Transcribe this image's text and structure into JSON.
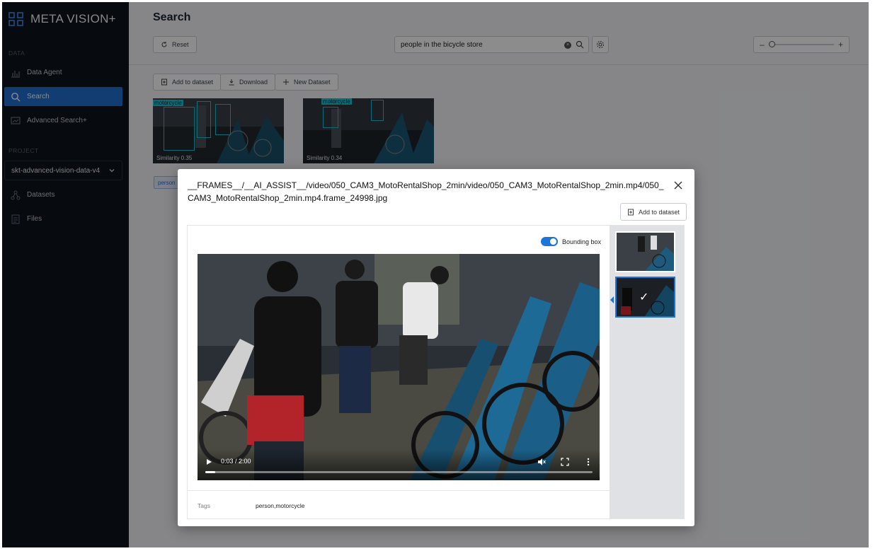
{
  "app": {
    "name": "META VISION+"
  },
  "sidebar": {
    "section_data": "DATA",
    "section_project": "PROJECT",
    "items": [
      {
        "label": "Data Agent",
        "icon": "bar-chart-icon"
      },
      {
        "label": "Search",
        "icon": "search-icon",
        "active": true
      },
      {
        "label": "Advanced Search+",
        "icon": "image-search-icon"
      }
    ],
    "project": "skt-advanced-vision-data-v4",
    "project_items": [
      {
        "label": "Datasets",
        "icon": "nodes-icon"
      },
      {
        "label": "Files",
        "icon": "file-icon"
      }
    ]
  },
  "page": {
    "title": "Search",
    "reset_label": "Reset",
    "search_value": "people in the bicycle store",
    "zoom_minus": "–",
    "zoom_plus": "+",
    "zoom_level": 0.0,
    "toolbar": {
      "add_label": "Add to dataset",
      "download_label": "Download",
      "new_label": "New Dataset"
    },
    "results": [
      {
        "label": "motorcycle",
        "similarity": "Similarity 0.35"
      },
      {
        "label": "motorcycle",
        "similarity": "Similarity 0.34"
      }
    ],
    "tag_chip": "person"
  },
  "modal": {
    "title": "__FRAMES__/__AI_ASSIST__/video/050_CAM3_MotoRentalShop_2min/video/050_CAM3_MotoRentalShop_2min.mp4/050_CAM3_MotoRentalShop_2min.mp4.frame_24998.jpg",
    "add_label": "Add to dataset",
    "bbox_label": "Bounding box",
    "bbox_on": true,
    "video": {
      "time": "0:03 / 2:00",
      "progress": 0.025
    },
    "tags_key": "Tags",
    "tags_value": "person,motorcycle"
  },
  "colors": {
    "accent": "#1e74d8",
    "bbox": "#18c4d8",
    "sidebar_bg": "#0e131b"
  }
}
